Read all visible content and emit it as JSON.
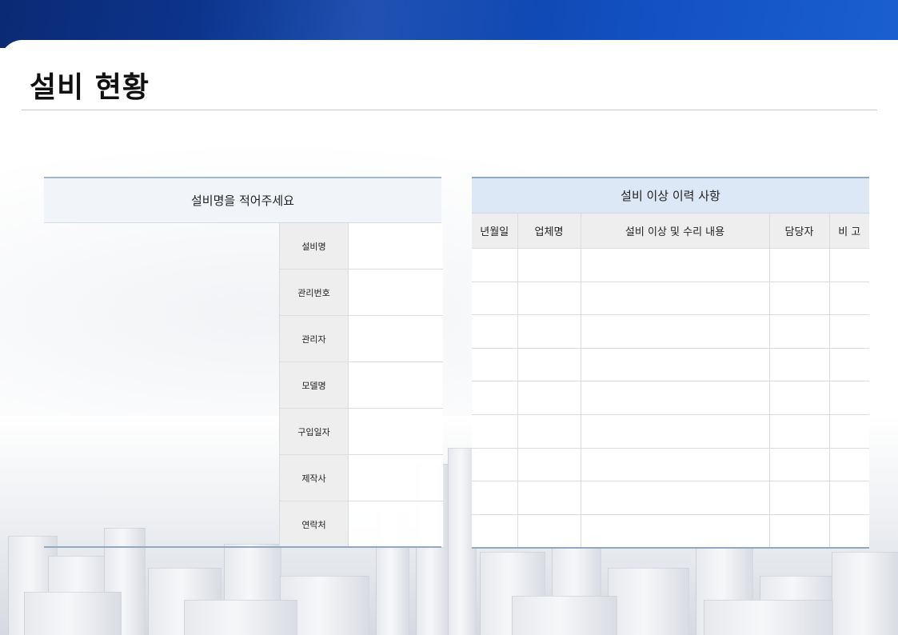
{
  "page": {
    "title": "설비 현황"
  },
  "equipment_card": {
    "header": "설비명을 적어주세요",
    "fields": [
      {
        "label": "설비명",
        "value": ""
      },
      {
        "label": "관리번호",
        "value": ""
      },
      {
        "label": "관리자",
        "value": ""
      },
      {
        "label": "모델명",
        "value": ""
      },
      {
        "label": "구입일자",
        "value": ""
      },
      {
        "label": "제작사",
        "value": ""
      },
      {
        "label": "연락처",
        "value": ""
      }
    ]
  },
  "history_table": {
    "caption": "설비 이상 이력 사항",
    "columns": [
      "년월일",
      "업체명",
      "설비 이상 및 수리 내용",
      "담당자",
      "비 고"
    ],
    "rows": [
      [
        "",
        "",
        "",
        "",
        ""
      ],
      [
        "",
        "",
        "",
        "",
        ""
      ],
      [
        "",
        "",
        "",
        "",
        ""
      ],
      [
        "",
        "",
        "",
        "",
        ""
      ],
      [
        "",
        "",
        "",
        "",
        ""
      ],
      [
        "",
        "",
        "",
        "",
        ""
      ],
      [
        "",
        "",
        "",
        "",
        ""
      ],
      [
        "",
        "",
        "",
        "",
        ""
      ],
      [
        "",
        "",
        "",
        "",
        ""
      ]
    ]
  },
  "colors": {
    "brand_blue": "#0c3a9a",
    "header_bg_left": "#f1f5fa",
    "header_bg_right": "#dce8f5",
    "label_bg": "#eeeeee",
    "rule": "#8fa9c2"
  }
}
